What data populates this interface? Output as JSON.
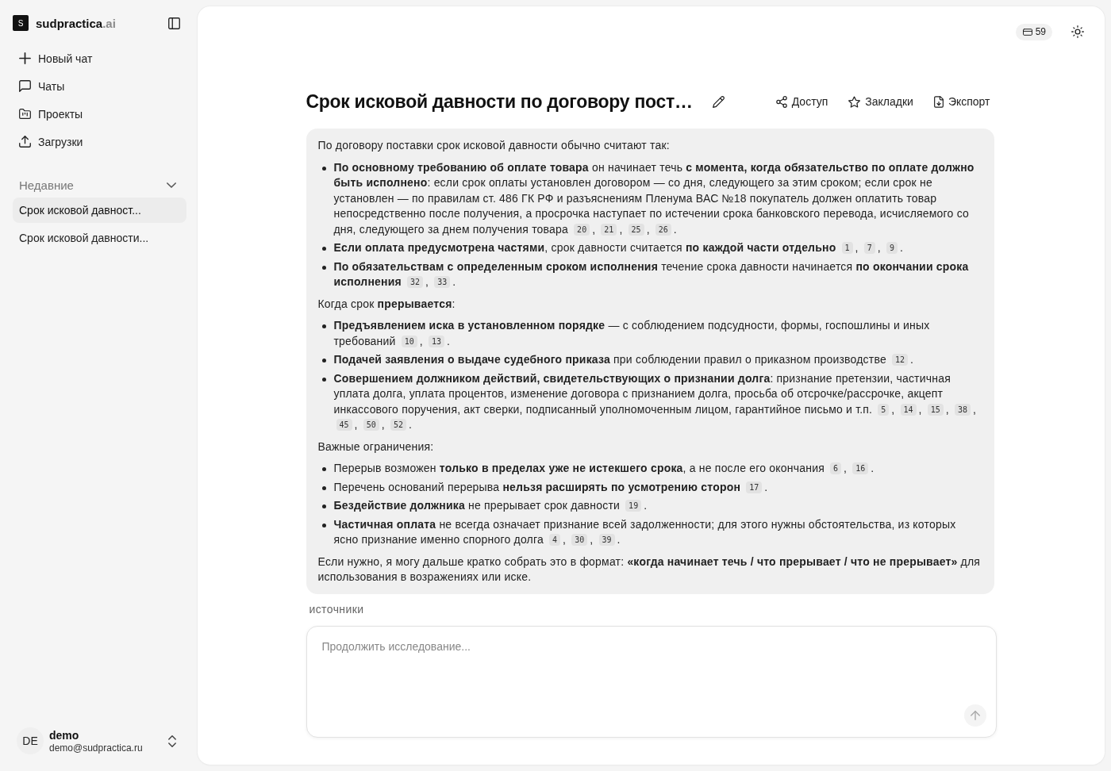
{
  "sidebar": {
    "logo": {
      "mark": "S",
      "name": "sudpractica",
      "suffix": ".ai"
    },
    "nav": [
      {
        "label": "Новый чат"
      },
      {
        "label": "Чаты"
      },
      {
        "label": "Проекты"
      },
      {
        "label": "Загрузки"
      }
    ],
    "recent": {
      "title": "Недавние",
      "expanded": true,
      "items": [
        {
          "label": "Срок исковой давност...",
          "selected": true
        },
        {
          "label": "Срок исковой давности...",
          "selected": false
        }
      ]
    },
    "user": {
      "initials": "DE",
      "name": "demo",
      "email": "demo@sudpractica.ru"
    }
  },
  "topbar": {
    "credits": "59"
  },
  "chat": {
    "title": "Срок исковой давности по договору пост…",
    "actions": [
      {
        "label": "Доступ"
      },
      {
        "label": "Закладки"
      },
      {
        "label": "Экспорт"
      }
    ],
    "message": {
      "citation_separator": ",",
      "blocks": [
        {
          "kind": "paragraph",
          "text": "По договору поставки срок исковой давности обычно считают так:"
        },
        {
          "kind": "list",
          "items": [
            {
              "text": "**По основному требованию об оплате товара** он начинает течь **с момента, когда обязательство по оплате должно быть исполнено**: если срок оплаты установлен договором — со дня, следующего за этим сроком; если срок не установлен — по правилам ст. 486 ГК РФ и разъяснениям Пленума ВАС №18 покупатель должен оплатить товар непосредственно после получения, а просрочка наступает по истечении срока банковского перевода, исчисляемого со дня, следующего за днем получения товара",
              "citations": [
                "20",
                "21",
                "25",
                "26"
              ],
              "end": "."
            },
            {
              "text": "**Если оплата предусмотрена частями**, срок давности считается **по каждой части отдельно**",
              "citations": [
                "1",
                "7",
                "9"
              ],
              "end": "."
            },
            {
              "text": "**По обязательствам с определенным сроком исполнения** течение срока давности начинается **по окончании срока исполнения**",
              "citations": [
                "32",
                "33"
              ],
              "end": "."
            }
          ]
        },
        {
          "kind": "paragraph",
          "text": "Когда срок **прерывается**:"
        },
        {
          "kind": "list",
          "items": [
            {
              "text": "**Предъявлением иска в установленном порядке** — с соблюдением подсудности, формы, госпошлины и иных требований",
              "citations": [
                "10",
                "13"
              ],
              "end": "."
            },
            {
              "text": "**Подачей заявления о выдаче судебного приказа** при соблюдении правил о приказном производстве",
              "citations": [
                "12"
              ],
              "end": "."
            },
            {
              "text": "**Совершением должником действий, свидетельствующих о признании долга**: признание претензии, частичная уплата долга, уплата процентов, изменение договора с признанием долга, просьба об отсрочке/рассрочке, акцепт инкассового поручения, акт сверки, подписанный уполномоченным лицом, гарантийное письмо и т.п.",
              "citations": [
                "5",
                "14",
                "15",
                "38",
                "45",
                "50",
                "52"
              ],
              "end": "."
            }
          ]
        },
        {
          "kind": "paragraph",
          "text": "Важные ограничения:"
        },
        {
          "kind": "list",
          "items": [
            {
              "text": "Перерыв возможен **только в пределах уже не истекшего срока**, а не после его окончания",
              "citations": [
                "6",
                "16"
              ],
              "end": "."
            },
            {
              "text": "Перечень оснований перерыва **нельзя расширять по усмотрению сторон**",
              "citations": [
                "17"
              ],
              "end": "."
            },
            {
              "text": "**Бездействие должника** не прерывает срок давности",
              "citations": [
                "19"
              ],
              "end": "."
            },
            {
              "text": "**Частичная оплата** не всегда означает признание всей задолженности; для этого нужны обстоятельства, из которых ясно признание именно спорного долга",
              "citations": [
                "4",
                "30",
                "39"
              ],
              "end": "."
            }
          ]
        },
        {
          "kind": "paragraph",
          "text": "Если нужно, я могу дальше кратко собрать это в формат: **«когда начинает течь / что прерывает / что не прерывает»** для использования в возражениях или иске."
        }
      ]
    },
    "sources": {
      "label": "источники"
    }
  },
  "composer": {
    "placeholder": "Продолжить исследование...",
    "send_button": {
      "disabled": true
    }
  }
}
